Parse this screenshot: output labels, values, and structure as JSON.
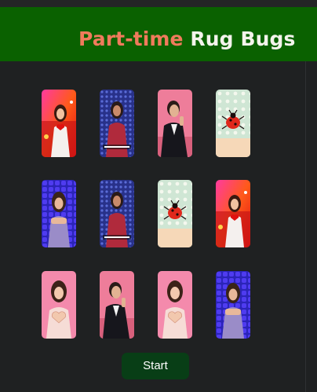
{
  "header": {
    "title_part1": "Part-time",
    "title_part2": "Rug Bugs",
    "title_colors": {
      "part1": "#f07b5c",
      "part2": "#f4f4ec"
    },
    "background": "#0a6100"
  },
  "board": {
    "rows": [
      [
        {
          "face": "red-heart-girl"
        },
        {
          "face": "blue-mirrorball-singer"
        },
        {
          "face": "pink-suit-man"
        },
        {
          "face": "polka-dot-bug"
        }
      ],
      [
        {
          "face": "blue-pattern-girl"
        },
        {
          "face": "blue-mirrorball-singer"
        },
        {
          "face": "polka-dot-bug"
        },
        {
          "face": "red-heart-girl"
        }
      ],
      [
        {
          "face": "pink-heart-hands-girl"
        },
        {
          "face": "pink-suit-man"
        },
        {
          "face": "pink-heart-hands-girl"
        },
        {
          "face": "blue-pattern-girl"
        }
      ]
    ]
  },
  "start_button": {
    "label": "Start",
    "color": "#083e16"
  }
}
